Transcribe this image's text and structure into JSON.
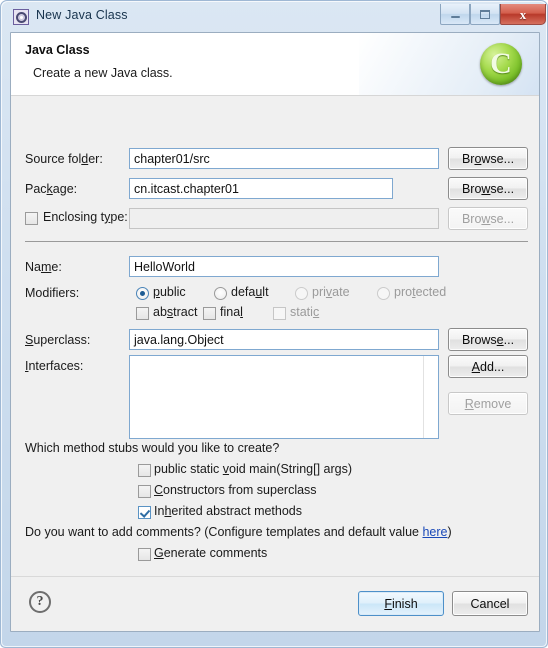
{
  "window": {
    "title": "New Java Class",
    "icon": "java-class-wizard-icon",
    "controls": {
      "minimize": "–",
      "maximize": "□",
      "close": "x"
    }
  },
  "banner": {
    "title": "Java Class",
    "subtitle": "Create a new Java class.",
    "icon_letter": "C",
    "icon_name": "java-class-banner-icon"
  },
  "form": {
    "source_folder": {
      "label": "Source folder:",
      "value": "chapter01/src",
      "button": "Browse..."
    },
    "package": {
      "label": "Package:",
      "value": "cn.itcast.chapter01",
      "button": "Browse..."
    },
    "enclosing_type": {
      "label": "Enclosing type:",
      "value": "",
      "checked": false,
      "button": "Browse...",
      "disabled": true
    },
    "name": {
      "label": "Name:",
      "value": "HelloWorld"
    },
    "modifiers": {
      "label": "Modifiers:",
      "radios": [
        {
          "label": "public",
          "selected": true,
          "disabled": false
        },
        {
          "label": "default",
          "selected": false,
          "disabled": false
        },
        {
          "label": "private",
          "selected": false,
          "disabled": true
        },
        {
          "label": "protected",
          "selected": false,
          "disabled": true
        }
      ],
      "checkboxes": [
        {
          "label": "abstract",
          "checked": false,
          "disabled": false
        },
        {
          "label": "final",
          "checked": false,
          "disabled": false
        },
        {
          "label": "static",
          "checked": false,
          "disabled": true
        }
      ]
    },
    "superclass": {
      "label": "Superclass:",
      "value": "java.lang.Object",
      "button": "Browse..."
    },
    "interfaces": {
      "label": "Interfaces:",
      "items": [],
      "add_button": "Add...",
      "remove_button": "Remove",
      "remove_disabled": true
    }
  },
  "stubs": {
    "question": "Which method stubs would you like to create?",
    "options": [
      {
        "label": "public static void main(String[] args)",
        "checked": false
      },
      {
        "label": "Constructors from superclass",
        "checked": false
      },
      {
        "label": "Inherited abstract methods",
        "checked": true
      }
    ]
  },
  "comments": {
    "question_prefix": "Do you want to add comments? (Configure templates and default value ",
    "link": "here",
    "question_suffix": ")",
    "option": {
      "label": "Generate comments",
      "checked": false
    }
  },
  "footer": {
    "help": "?",
    "finish": "Finish",
    "cancel": "Cancel"
  },
  "colors": {
    "accent": "#1d5c94",
    "link": "#1a49b8",
    "dialog_bg": "#f0f0f0",
    "field_border": "#7fa8d0"
  }
}
